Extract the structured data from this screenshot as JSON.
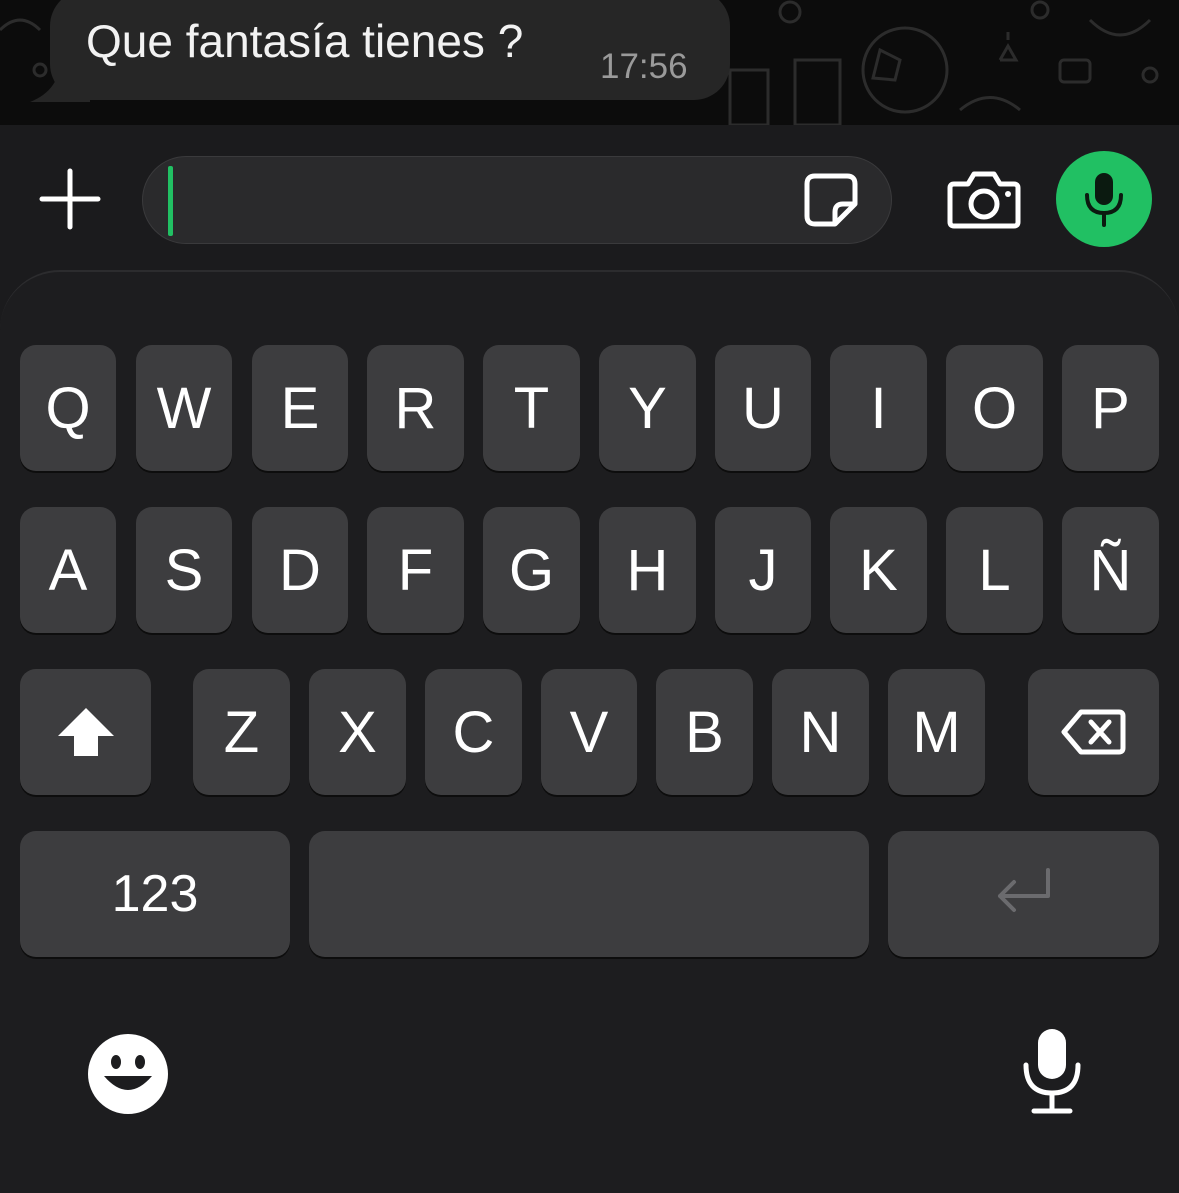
{
  "chat": {
    "message_text": "Que fantasía tienes ?",
    "message_time": "17:56"
  },
  "composer": {
    "attach_icon": "plus-icon",
    "sticker_icon": "sticker-icon",
    "camera_icon": "camera-icon",
    "voice_icon": "microphone-icon",
    "accent_color": "#21c063"
  },
  "keyboard": {
    "row1": [
      "Q",
      "W",
      "E",
      "R",
      "T",
      "Y",
      "U",
      "I",
      "O",
      "P"
    ],
    "row2": [
      "A",
      "S",
      "D",
      "F",
      "G",
      "H",
      "J",
      "K",
      "L",
      "Ñ"
    ],
    "row3": [
      "Z",
      "X",
      "C",
      "V",
      "B",
      "N",
      "M"
    ],
    "numbers_label": "123",
    "shift_icon": "shift-icon",
    "backspace_icon": "backspace-icon",
    "return_icon": "return-icon",
    "emoji_icon": "emoji-icon",
    "dictation_icon": "microphone-icon"
  }
}
